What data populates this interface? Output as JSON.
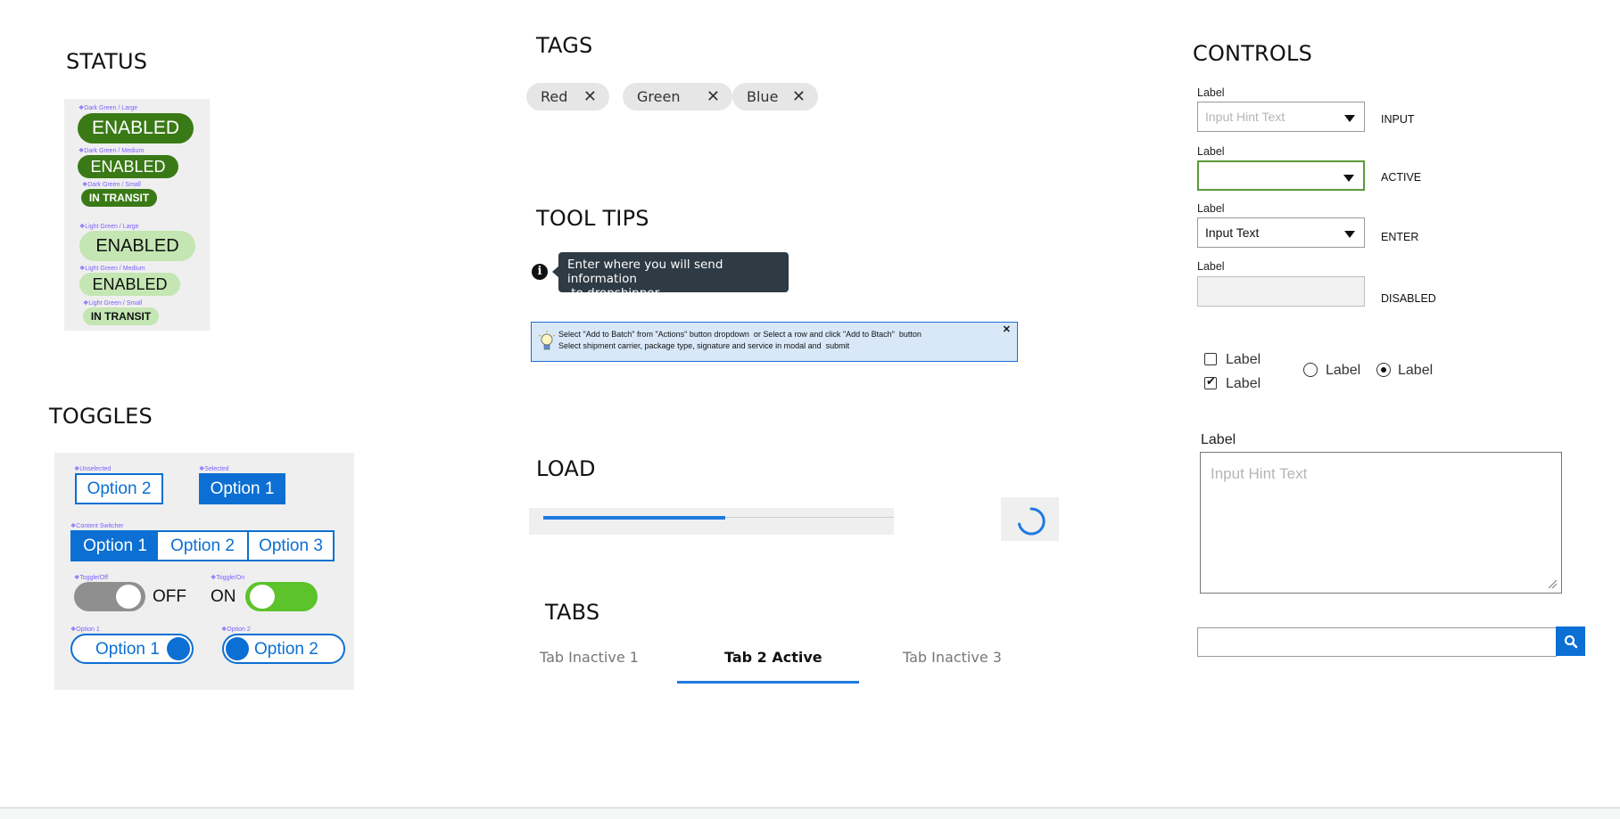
{
  "status": {
    "heading": "STATUS",
    "captions": [
      "Dark Green / Large",
      "Dark Green / Medium",
      "Dark Green / Small",
      "Light Green / Large",
      "Light Green / Medium",
      "Light Green / Small"
    ],
    "badges": [
      "ENABLED",
      "ENABLED",
      "IN TRANSIT",
      "ENABLED",
      "ENABLED",
      "IN TRANSIT"
    ],
    "colors": {
      "dark_green": "#3a7a16",
      "light_green": "#c4e6b3"
    }
  },
  "toggles": {
    "heading": "TOGGLES",
    "unselected_caption": "Unselected",
    "unselected_label": "Option 2",
    "selected_caption": "Selected",
    "selected_label": "Option 1",
    "switcher_caption": "Content Switcher",
    "switcher_options": [
      "Option 1",
      "Option 2",
      "Option 3"
    ],
    "toggle_off_caption": "Toggle/Off",
    "toggle_off_label": "OFF",
    "toggle_on_caption": "Toggle/On",
    "toggle_on_label": "ON",
    "option1_caption": "Option 1",
    "option1_label": "Option 1",
    "option2_caption": "Option 2",
    "option2_label": "Option 2",
    "colors": {
      "blue": "#0b6fd3",
      "toggle_on": "#5cc32a",
      "toggle_off": "#8f8f8f"
    }
  },
  "tags": {
    "heading": "TAGS",
    "items": [
      "Red",
      "Green",
      "Blue"
    ],
    "remove_icon": "close-icon"
  },
  "tooltips": {
    "heading": "TOOL TIPS",
    "tooltip_line1": "Enter where you will send information",
    "tooltip_line2": " to dropshipper.",
    "info_icon": "info-icon",
    "banner_line1": "Select \"Add to Batch\" from \"Actions\" button dropdown  or Select a row and click \"Add to Btach\"  button",
    "banner_line2": "Select shipment carrier, package type, signature and service in modal and  submit",
    "banner_icon": "lightbulb-icon",
    "close_icon": "close-icon"
  },
  "load": {
    "heading": "LOAD",
    "progress": 0.52,
    "spinner_icon": "spinner-icon"
  },
  "tabs": {
    "heading": "TABS",
    "items": [
      "Tab Inactive 1",
      "Tab 2 Active",
      "Tab Inactive 3"
    ],
    "active_index": 1
  },
  "controls": {
    "heading": "CONTROLS",
    "fields": [
      {
        "label": "Label",
        "value": "Input Hint Text",
        "state": "INPUT"
      },
      {
        "label": "Label",
        "value": "",
        "state": "ACTIVE"
      },
      {
        "label": "Label",
        "value": "Input Text",
        "state": "ENTER"
      },
      {
        "label": "Label",
        "value": "",
        "state": "DISABLED"
      }
    ],
    "checkbox_unchecked": "Label",
    "checkbox_checked": "Label",
    "radio_unselected": "Label",
    "radio_selected": "Label",
    "textarea_label": "Label",
    "textarea_placeholder": "Input Hint Text",
    "search_icon": "search-icon"
  }
}
